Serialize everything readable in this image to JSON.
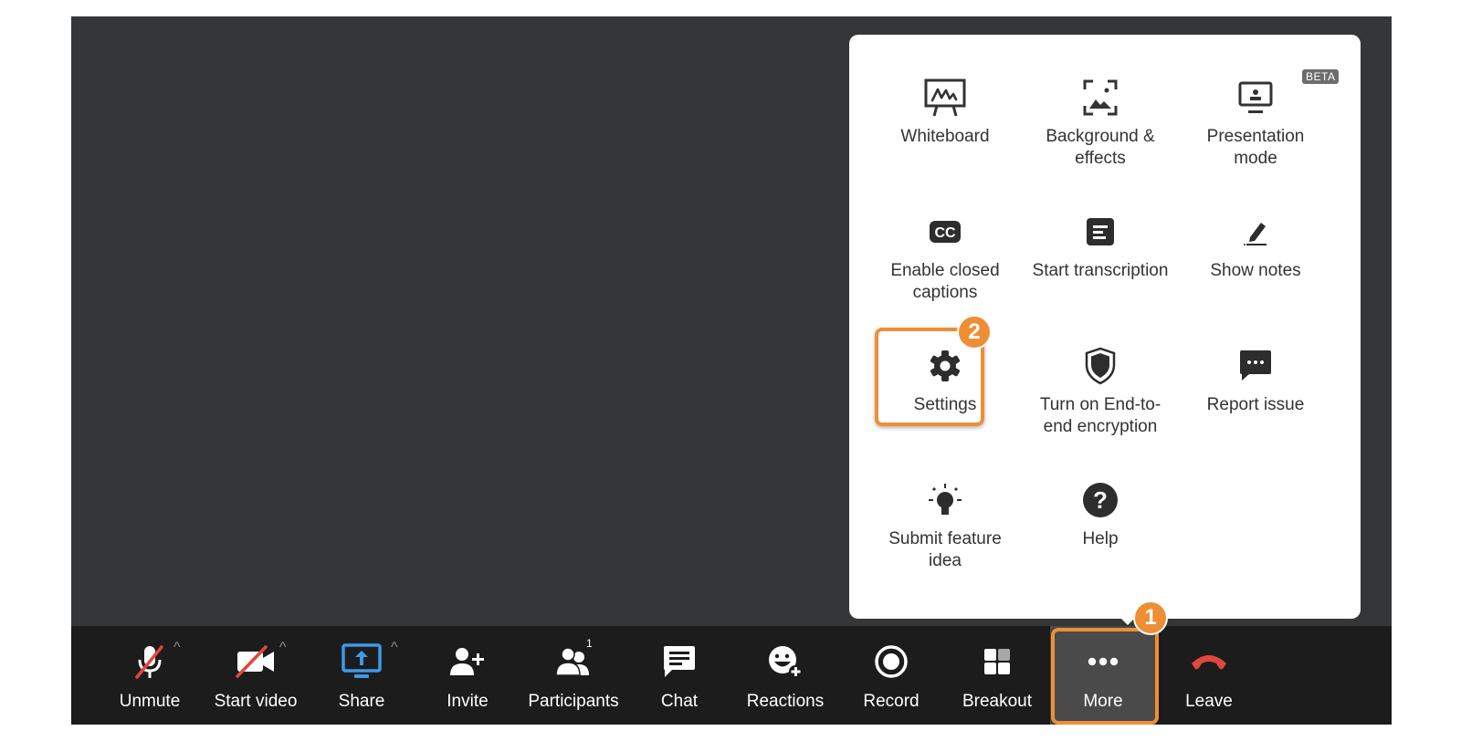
{
  "colors": {
    "accent_orange": "#ee8f35",
    "share_blue": "#3d9ae8",
    "leave_red": "#e0473e",
    "mute_slash_red": "#e0473e",
    "meeting_bg": "#353637",
    "toolbar_bg": "#1c1c1c"
  },
  "toolbar": {
    "items": [
      {
        "label": "Unmute",
        "icon": "microphone-muted-icon",
        "has_caret": true
      },
      {
        "label": "Start video",
        "icon": "video-off-icon",
        "has_caret": true
      },
      {
        "label": "Share",
        "icon": "share-screen-icon",
        "has_caret": true
      },
      {
        "label": "Invite",
        "icon": "add-user-icon"
      },
      {
        "label": "Participants",
        "icon": "participants-icon",
        "count": "1"
      },
      {
        "label": "Chat",
        "icon": "chat-icon"
      },
      {
        "label": "Reactions",
        "icon": "reactions-icon"
      },
      {
        "label": "Record",
        "icon": "record-icon"
      },
      {
        "label": "Breakout",
        "icon": "breakout-icon"
      },
      {
        "label": "More",
        "icon": "more-icon",
        "active": true
      },
      {
        "label": "Leave",
        "icon": "leave-phone-icon"
      }
    ]
  },
  "more_menu": {
    "items": [
      {
        "label_lines": [
          "Whiteboard"
        ],
        "icon": "whiteboard-icon"
      },
      {
        "label_lines": [
          "Background &",
          "effects"
        ],
        "icon": "background-effects-icon"
      },
      {
        "label_lines": [
          "Presentation",
          "mode"
        ],
        "icon": "presentation-mode-icon",
        "badge": "BETA"
      },
      {
        "label_lines": [
          "Enable closed",
          "captions"
        ],
        "icon": "closed-captions-icon"
      },
      {
        "label_lines": [
          "Start transcription"
        ],
        "icon": "transcription-icon"
      },
      {
        "label_lines": [
          "Show notes"
        ],
        "icon": "notes-pencil-icon"
      },
      {
        "label_lines": [
          "Settings"
        ],
        "icon": "gear-icon"
      },
      {
        "label_lines": [
          "Turn on End-to-",
          "end encryption"
        ],
        "icon": "shield-icon"
      },
      {
        "label_lines": [
          "Report issue"
        ],
        "icon": "report-issue-icon"
      },
      {
        "label_lines": [
          "Submit feature",
          "idea"
        ],
        "icon": "lightbulb-icon"
      },
      {
        "label_lines": [
          "Help"
        ],
        "icon": "help-icon"
      }
    ]
  },
  "annotations": {
    "step1": "1",
    "step2": "2"
  }
}
